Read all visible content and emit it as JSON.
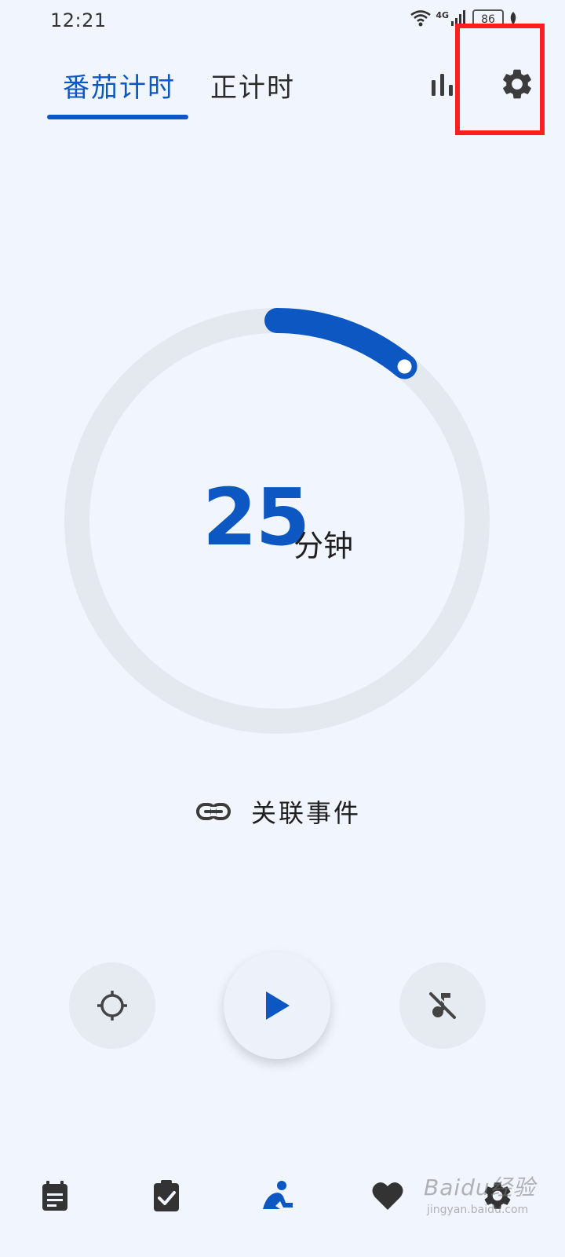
{
  "status_bar": {
    "time": "12:21",
    "network": "4G",
    "battery": "86",
    "icons": [
      "wifi-icon",
      "signal-icon",
      "battery-icon",
      "leaf-icon"
    ]
  },
  "tabs": [
    {
      "label": "番茄计时",
      "active": true
    },
    {
      "label": "正计时",
      "active": false
    }
  ],
  "header_icons": [
    "stats-icon",
    "gear-icon"
  ],
  "timer": {
    "value": "25",
    "unit": "分钟",
    "progress": 0.11
  },
  "link_event": {
    "icon": "link-icon",
    "label": "关联事件"
  },
  "controls": [
    {
      "name": "focus-mode-button",
      "icon": "crosshair-icon"
    },
    {
      "name": "play-button",
      "icon": "play-icon"
    },
    {
      "name": "white-noise-button",
      "icon": "music-off-icon"
    }
  ],
  "bottom_nav": [
    {
      "name": "nav-schedule",
      "icon": "notes-icon",
      "active": false
    },
    {
      "name": "nav-checklist",
      "icon": "clipboard-check-icon",
      "active": false
    },
    {
      "name": "nav-focus",
      "icon": "meditation-icon",
      "active": true
    },
    {
      "name": "nav-favorites",
      "icon": "heart-icon",
      "active": false
    },
    {
      "name": "nav-settings",
      "icon": "gear-icon",
      "active": false
    }
  ],
  "watermark": {
    "text": "Baidu经验",
    "sub": "jingyan.baidu.com"
  },
  "colors": {
    "accent": "#0c57c2",
    "background": "#f1f5fd",
    "track": "#e4e9f0",
    "highlight": "#ff1f1f"
  }
}
